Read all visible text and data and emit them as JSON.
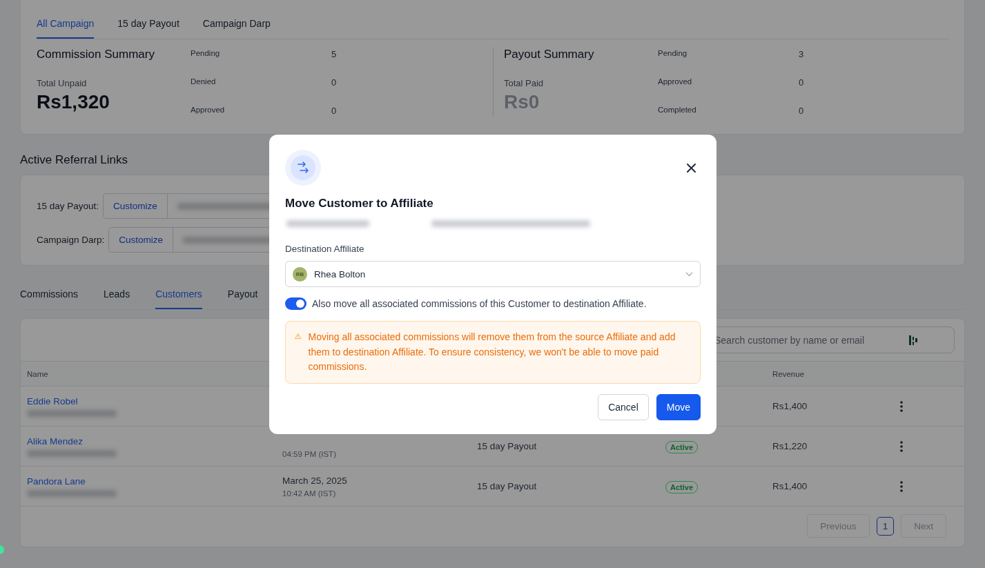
{
  "campaign_tabs": [
    {
      "label": "All Campaign",
      "selected": true
    },
    {
      "label": "15 day Payout",
      "selected": false
    },
    {
      "label": "Campaign Darp",
      "selected": false
    }
  ],
  "summaries": [
    {
      "title": "Commission Summary",
      "total_label": "Total Unpaid",
      "total": "Rs1,320",
      "muted": false,
      "stats": [
        {
          "label": "Pending",
          "value": "5"
        },
        {
          "label": "Denied",
          "value": "0"
        },
        {
          "label": "Approved",
          "value": "0"
        }
      ]
    },
    {
      "title": "Payout Summary",
      "total_label": "Total Paid",
      "total": "Rs0",
      "muted": true,
      "stats": [
        {
          "label": "Pending",
          "value": "3"
        },
        {
          "label": "Approved",
          "value": "0"
        },
        {
          "label": "Completed",
          "value": "0"
        }
      ]
    }
  ],
  "referral": {
    "title": "Active Referral Links",
    "links": [
      {
        "label": "15 day Payout:",
        "button": "Customize"
      },
      {
        "label": "Campaign Darp:",
        "button": "Customize"
      }
    ]
  },
  "section_tabs": [
    {
      "label": "Commissions",
      "selected": false
    },
    {
      "label": "Leads",
      "selected": false
    },
    {
      "label": "Customers",
      "selected": true
    },
    {
      "label": "Payout",
      "selected": false
    }
  ],
  "search": {
    "placeholder": "Search customer by name or email"
  },
  "table": {
    "columns": [
      "Name",
      "Revenue"
    ],
    "rows": [
      {
        "name": "Eddie Robel",
        "revenue": "Rs1,400"
      },
      {
        "name": "Alika Mendez",
        "time": "04:59 PM (IST)",
        "campaign": "15 day Payout",
        "status": "Active",
        "revenue": "Rs1,220"
      },
      {
        "name": "Pandora Lane",
        "date": "March 25, 2025",
        "time": "10:42 AM (IST)",
        "campaign": "15 day Payout",
        "status": "Active",
        "revenue": "Rs1,400"
      }
    ]
  },
  "pagination": [
    {
      "label": "Previous",
      "kind": "nav",
      "disabled": true,
      "selected": false
    },
    {
      "label": "1",
      "kind": "page",
      "disabled": false,
      "selected": true
    },
    {
      "label": "Next",
      "kind": "nav",
      "disabled": true,
      "selected": false
    }
  ],
  "modal": {
    "title": "Move Customer to Affiliate",
    "field_label": "Destination Affiliate",
    "affiliate": {
      "initials": "RB",
      "name": "Rhea Bolton"
    },
    "toggle": {
      "label": "Also move all associated commissions of this Customer to destination Affiliate.",
      "on": true
    },
    "warning": "Moving all associated commissions will remove them from the source Affiliate and add them to destination Affiliate. To ensure consistency, we won't be able to move paid commissions.",
    "buttons": [
      {
        "label": "Cancel",
        "kind": "secondary"
      },
      {
        "label": "Move",
        "kind": "primary"
      }
    ]
  }
}
